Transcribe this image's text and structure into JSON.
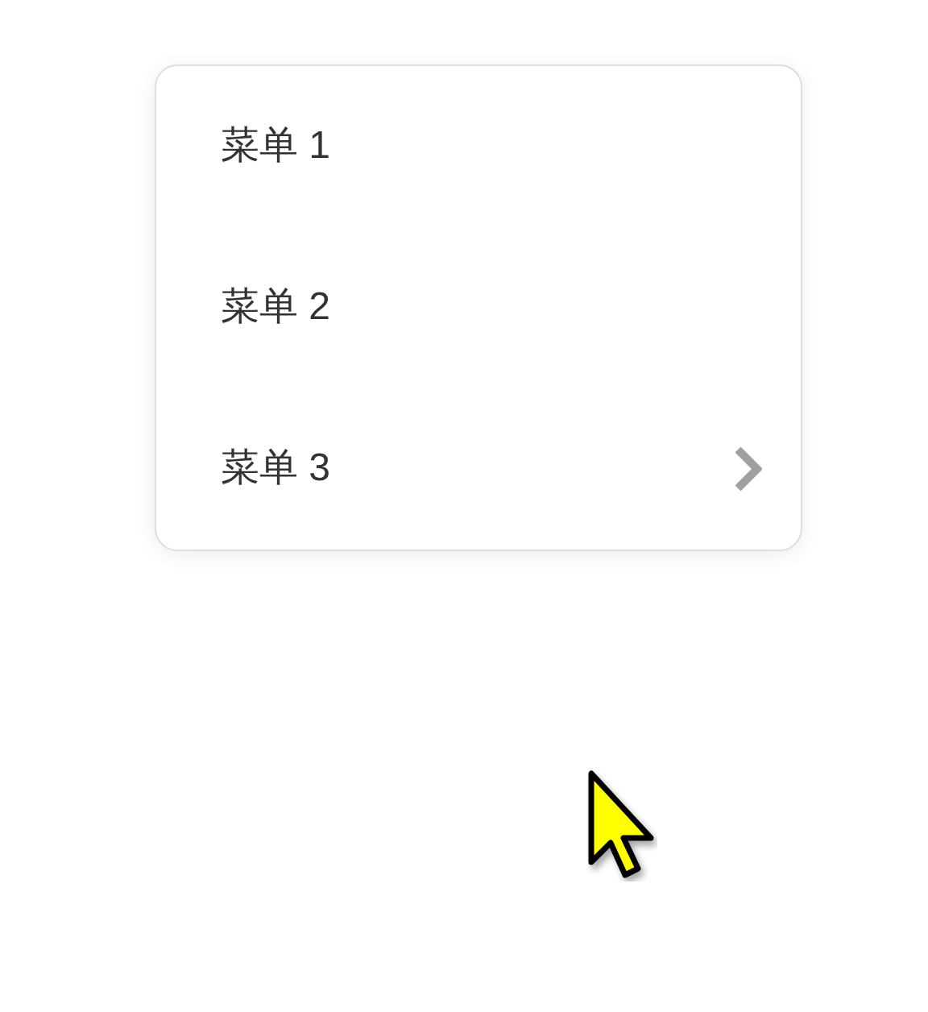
{
  "menu": {
    "items": [
      {
        "label": "菜单 1",
        "has_submenu": false
      },
      {
        "label": "菜单 2",
        "has_submenu": false
      },
      {
        "label": "菜单 3",
        "has_submenu": true
      }
    ]
  }
}
